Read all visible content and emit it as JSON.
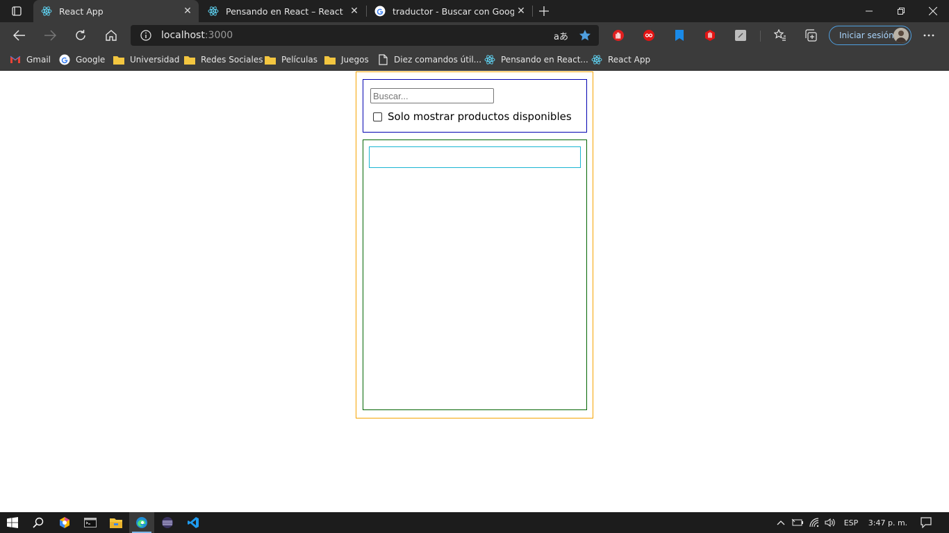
{
  "browser": {
    "tabs": [
      {
        "title": "React App",
        "icon": "react-icon",
        "active": true
      },
      {
        "title": "Pensando en React – React",
        "icon": "react-icon",
        "active": false
      },
      {
        "title": "traductor - Buscar con Google",
        "icon": "google-icon",
        "active": false
      }
    ],
    "address": {
      "host": "localhost",
      "port": ":3000"
    },
    "signin_label": "Iniciar sesión",
    "bookmarks": [
      {
        "label": "Gmail",
        "icon": "gmail-icon"
      },
      {
        "label": "Google",
        "icon": "google-icon"
      },
      {
        "label": "Universidad",
        "icon": "folder-icon"
      },
      {
        "label": "Redes Sociales",
        "icon": "folder-icon"
      },
      {
        "label": "Películas",
        "icon": "folder-icon"
      },
      {
        "label": "Juegos",
        "icon": "folder-icon"
      },
      {
        "label": "Diez comandos útil...",
        "icon": "page-icon"
      },
      {
        "label": "Pensando en React...",
        "icon": "react-icon"
      },
      {
        "label": "React App",
        "icon": "react-icon"
      }
    ],
    "colors": {
      "accent": "#4f9fdf",
      "frame": "#202020",
      "toolbar": "#3b3b3b"
    }
  },
  "app": {
    "search_placeholder": "Buscar...",
    "search_value": "",
    "stock_only_label": "Solo mostrar productos disponibles",
    "stock_only_checked": false,
    "colors": {
      "container": "#f5a300",
      "searchbar": "#0000b0",
      "table": "#006400",
      "table_head": "#19b5d2"
    }
  },
  "taskbar": {
    "language": "ESP",
    "clock": "3:47 p. m."
  }
}
